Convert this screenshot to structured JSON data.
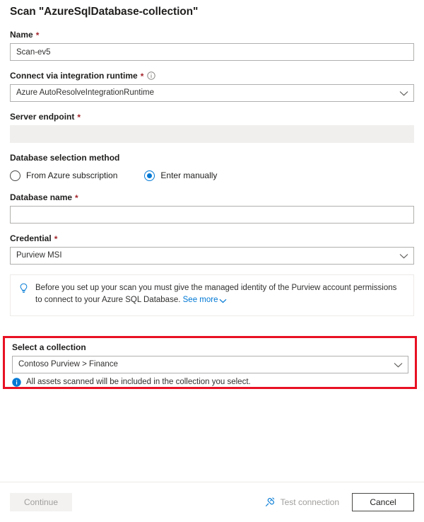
{
  "dialog": {
    "title": "Scan \"AzureSqlDatabase-collection\""
  },
  "form": {
    "name": {
      "label": "Name",
      "required_mark": "*",
      "value": "Scan-ev5",
      "placeholder": ""
    },
    "integration_runtime": {
      "label": "Connect via integration runtime",
      "required_mark": "*",
      "info_icon": "info-circle-icon",
      "value": "Azure AutoResolveIntegrationRuntime"
    },
    "server_endpoint": {
      "label": "Server endpoint",
      "required_mark": "*",
      "value": "",
      "placeholder": ""
    },
    "database_selection_method": {
      "label": "Database selection method",
      "options": [
        {
          "label": "From Azure subscription",
          "selected": false
        },
        {
          "label": "Enter manually",
          "selected": true
        }
      ]
    },
    "database_name": {
      "label": "Database name",
      "required_mark": "*",
      "value": "",
      "placeholder": ""
    },
    "credential": {
      "label": "Credential",
      "required_mark": "*",
      "value": "Purview MSI"
    },
    "message_bar": {
      "icon": "lightbulb-icon",
      "text": "Before you set up your scan you must give the managed identity of the Purview account permissions to connect to your Azure SQL Database.",
      "link_label": "See more",
      "link_chevron": "chevron-down-icon"
    },
    "collection": {
      "label": "Select a collection",
      "value": "Contoso Purview > Finance",
      "note_icon": "info-filled-icon",
      "note": "All assets scanned will be included in the collection you select."
    }
  },
  "footer": {
    "continue_label": "Continue",
    "test_connection_label": "Test connection",
    "test_connection_icon": "plug-icon",
    "cancel_label": "Cancel"
  },
  "colors": {
    "accent": "#0078d4",
    "required": "#a4262c",
    "highlight": "#e81123",
    "disabled_text": "#a19f9d"
  }
}
